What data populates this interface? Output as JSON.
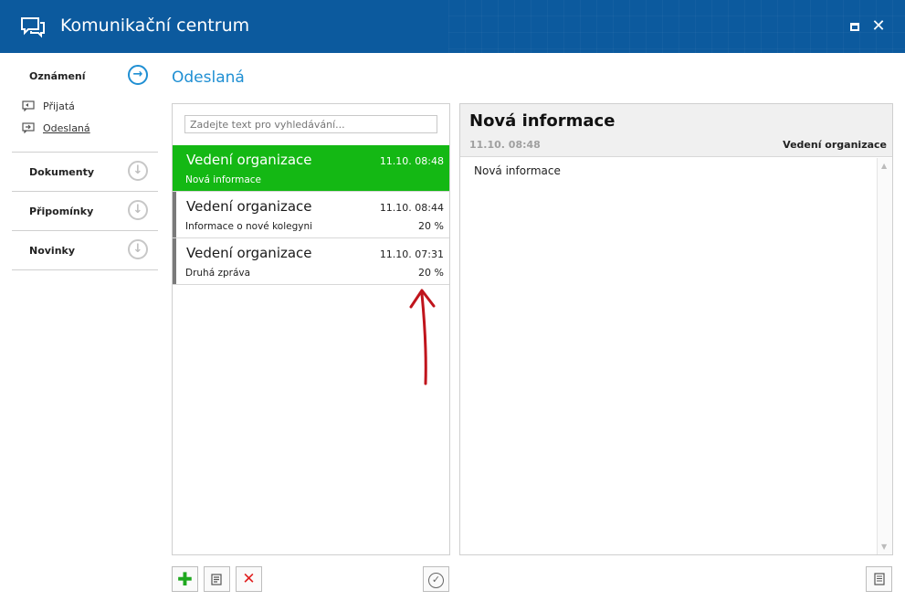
{
  "window": {
    "title": "Komunikační centrum",
    "maximize_icon": "maximize-icon",
    "close_label": "✕"
  },
  "sidebar": {
    "groups": [
      {
        "label": "Oznámení",
        "icon": "arrow-right-circle-icon",
        "active": true,
        "items": [
          {
            "label": "Přijatá",
            "icon": "inbox-icon",
            "selected": false
          },
          {
            "label": "Odeslaná",
            "icon": "sent-icon",
            "selected": true
          }
        ]
      },
      {
        "label": "Dokumenty",
        "icon": "arrow-down-circle-icon",
        "active": false
      },
      {
        "label": "Připomínky",
        "icon": "arrow-down-circle-icon",
        "active": false
      },
      {
        "label": "Novinky",
        "icon": "arrow-down-circle-icon",
        "active": false
      }
    ]
  },
  "main": {
    "section_title": "Odeslaná",
    "search": {
      "placeholder": "Zadejte text pro vyhledávání..."
    },
    "messages": [
      {
        "from": "Vedení organizace",
        "time": "11.10. 08:48",
        "subject": "Nová informace",
        "percent": "",
        "selected": true
      },
      {
        "from": "Vedení organizace",
        "time": "11.10. 08:44",
        "subject": "Informace o nové kolegyni",
        "percent": "20 %",
        "selected": false
      },
      {
        "from": "Vedení organizace",
        "time": "11.10. 07:31",
        "subject": "Druhá zpráva",
        "percent": "20 %",
        "selected": false
      }
    ]
  },
  "detail": {
    "title": "Nová informace",
    "date": "11.10. 08:48",
    "from": "Vedení organizace",
    "body": "Nová informace"
  },
  "toolbar": {
    "add_icon": "plus-icon",
    "edit_icon": "edit-icon",
    "delete_icon": "delete-icon",
    "confirm_icon": "check-circle-icon",
    "document_icon": "document-icon"
  },
  "colors": {
    "titlebar": "#0c5a9e",
    "accent": "#1f8fd3",
    "selected_row": "#14b814",
    "annotation_arrow": "#c0141c"
  }
}
